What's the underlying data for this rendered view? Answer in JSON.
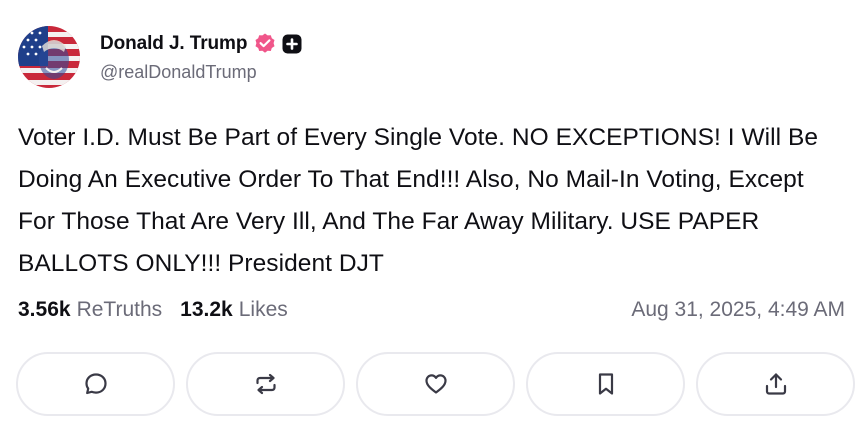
{
  "author": {
    "display_name": "Donald J. Trump",
    "handle": "@realDonaldTrump",
    "verified_icon": "verified-badge-icon",
    "plus_icon": "plus-badge-icon",
    "verified_color": "#f0568a"
  },
  "post": {
    "text": "Voter I.D. Must Be Part of Every Single Vote. NO EXCEPTIONS! I Will Be Doing An Executive Order To That End!!! Also, No Mail-In Voting, Except For Those That Are Very Ill, And The Far Away Military. USE PAPER BALLOTS ONLY!!! President DJT"
  },
  "stats": {
    "retruths_count": "3.56k",
    "retruths_label": "ReTruths",
    "likes_count": "13.2k",
    "likes_label": "Likes",
    "timestamp": "Aug 31, 2025, 4:49 AM"
  },
  "actions": [
    {
      "icon": "comment-icon"
    },
    {
      "icon": "retruth-icon"
    },
    {
      "icon": "heart-icon"
    },
    {
      "icon": "bookmark-icon"
    },
    {
      "icon": "share-icon"
    }
  ]
}
